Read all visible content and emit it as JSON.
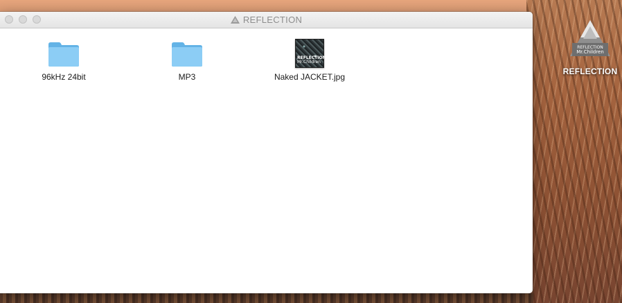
{
  "window": {
    "title": "REFLECTION",
    "title_icon": "disk-image-icon"
  },
  "items": [
    {
      "label": "96kHz 24bit",
      "icon": "folder-icon"
    },
    {
      "label": "MP3",
      "icon": "folder-icon"
    },
    {
      "label": "Naked JACKET.jpg",
      "icon": "jpg-thumbnail-icon",
      "thumb_text_1": "REFLECTION",
      "thumb_text_2": "Mr.Children"
    }
  ],
  "desktop": {
    "volume_label": "REFLECTION",
    "volume_icon_text_1": "REFLECTION",
    "volume_icon_text_2": "Mr.Children"
  },
  "colors": {
    "folder": "#79c3f0",
    "title_text": "#8d8d8d"
  }
}
